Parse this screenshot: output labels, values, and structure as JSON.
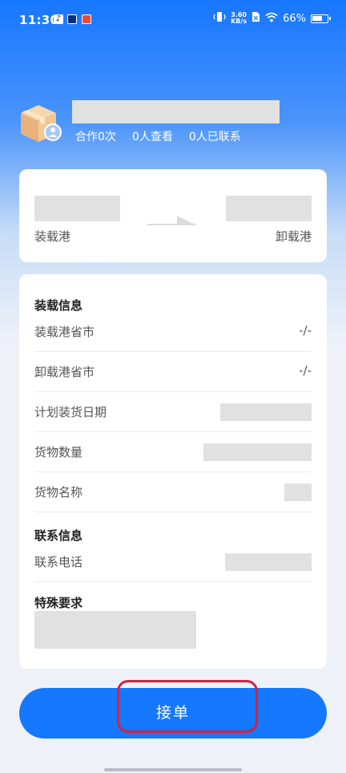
{
  "status_bar": {
    "time": "11:30",
    "net_speed_value": "3.60",
    "net_speed_unit": "KB/s",
    "battery": "66%"
  },
  "header": {
    "stats": [
      "合作0次",
      "0人查看",
      "0人已联系"
    ]
  },
  "route": {
    "loading_label": "装载港",
    "unloading_label": "卸载港"
  },
  "loading_info": {
    "title": "装载信息",
    "rows": [
      {
        "label": "装载港省市",
        "value": "-/-"
      },
      {
        "label": "卸载港省市",
        "value": "-/-"
      },
      {
        "label": "计划装货日期"
      },
      {
        "label": "货物数量"
      },
      {
        "label": "货物名称"
      }
    ]
  },
  "contact_info": {
    "title": "联系信息",
    "phone_label": "联系电话"
  },
  "special": {
    "title": "特殊要求"
  },
  "action": {
    "accept_label": "接单"
  },
  "colors": {
    "primary": "#1677ff",
    "highlight": "#d6223a",
    "placeholder": "#e1e1e1"
  }
}
